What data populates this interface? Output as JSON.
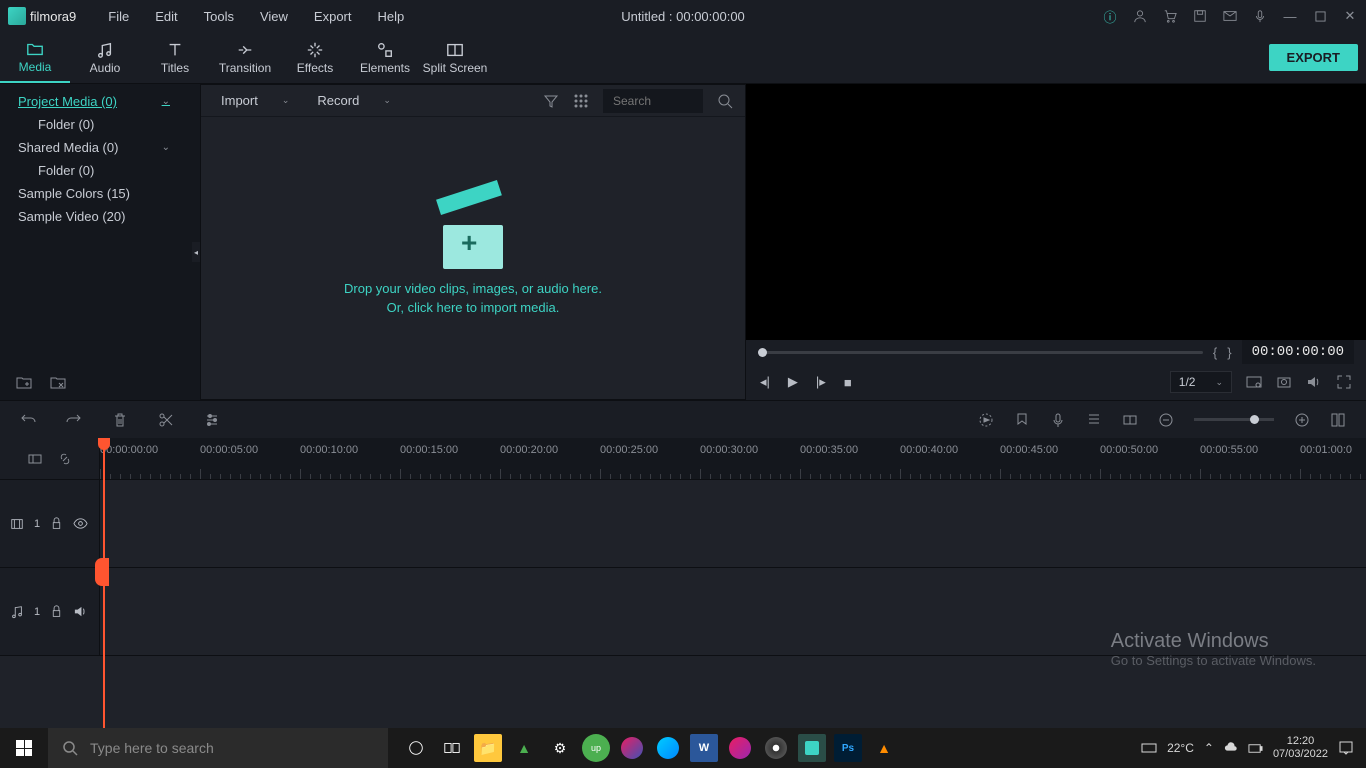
{
  "app": {
    "name": "filmora9",
    "title": "Untitled : 00:00:00:00"
  },
  "menu": [
    "File",
    "Edit",
    "Tools",
    "View",
    "Export",
    "Help"
  ],
  "tabs": [
    {
      "label": "Media",
      "active": true
    },
    {
      "label": "Audio"
    },
    {
      "label": "Titles"
    },
    {
      "label": "Transition"
    },
    {
      "label": "Effects"
    },
    {
      "label": "Elements"
    },
    {
      "label": "Split Screen"
    }
  ],
  "export_label": "EXPORT",
  "media_tree": [
    {
      "label": "Project Media (0)",
      "active": true,
      "expandable": true
    },
    {
      "label": "Folder (0)",
      "indent": true
    },
    {
      "label": "Shared Media (0)",
      "expandable": true
    },
    {
      "label": "Folder (0)",
      "indent": true
    },
    {
      "label": "Sample Colors (15)"
    },
    {
      "label": "Sample Video (20)"
    }
  ],
  "browser": {
    "import_label": "Import",
    "record_label": "Record",
    "search_placeholder": "Search",
    "drop_line1": "Drop your video clips, images, or audio here.",
    "drop_line2": "Or, click here to import media."
  },
  "preview": {
    "timecode": "00:00:00:00",
    "zoom": "1/2"
  },
  "ruler_marks": [
    "00:00:00:00",
    "00:00:05:00",
    "00:00:10:00",
    "00:00:15:00",
    "00:00:20:00",
    "00:00:25:00",
    "00:00:30:00",
    "00:00:35:00",
    "00:00:40:00",
    "00:00:45:00",
    "00:00:50:00",
    "00:00:55:00",
    "00:01:00:0"
  ],
  "tracks": {
    "video": "1",
    "audio": "1"
  },
  "watermark": {
    "title": "Activate Windows",
    "sub": "Go to Settings to activate Windows."
  },
  "taskbar": {
    "search_placeholder": "Type here to search",
    "temp": "22°C",
    "time": "12:20",
    "date": "07/03/2022"
  }
}
